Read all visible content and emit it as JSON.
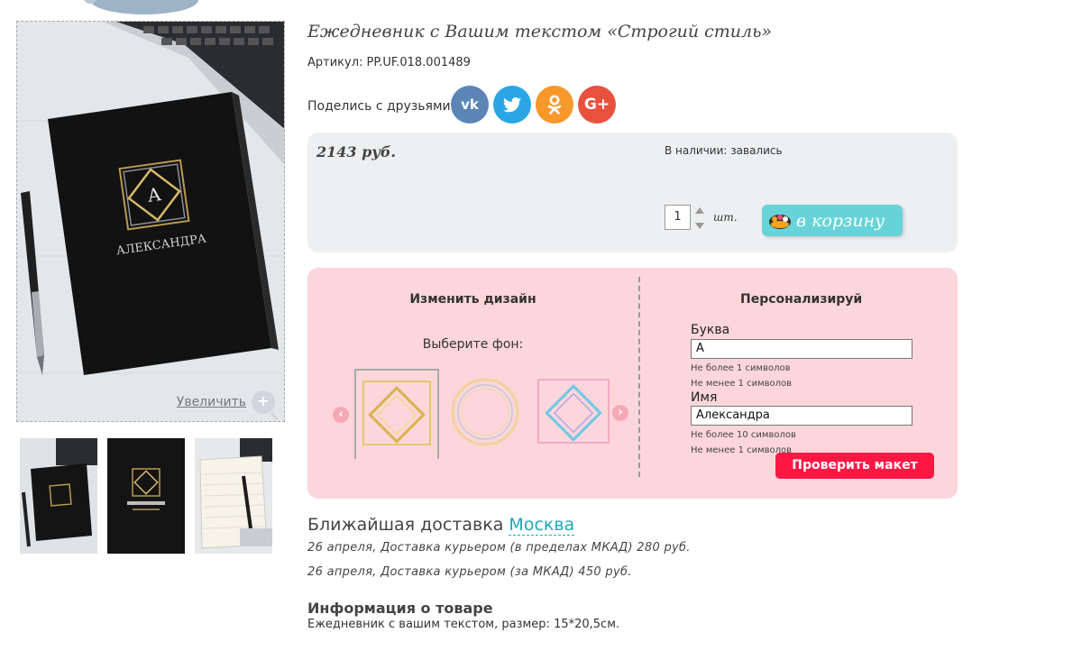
{
  "product": {
    "title": "Ежедневник с Вашим текстом «Строгий стиль»",
    "sku_label": "Артикул: PP.UF.018.001489",
    "share_label": "Поделись с друзьями:",
    "socials": [
      "vk",
      "twitter",
      "odnoklassniki",
      "google-plus"
    ],
    "cover_text": "АЛЕКСАНДРА",
    "cover_letter": "А",
    "zoom_label": "Увеличить"
  },
  "purchase": {
    "price": "2143 руб.",
    "stock": "В наличии: завались",
    "quantity": "1",
    "unit": "шт.",
    "cart_button": "в корзину"
  },
  "design": {
    "heading": "Изменить дизайн",
    "background_label": "Выберите фон:"
  },
  "personalize": {
    "heading": "Персонализируй",
    "letter_label": "Буква",
    "letter_value": "А",
    "letter_max": "Не более 1 символов",
    "letter_min": "Не менее 1 символов",
    "name_label": "Имя",
    "name_value": "Александра",
    "name_max": "Не более 10 символов",
    "name_min": "Не менее 1 символов",
    "check_button": "Проверить макет"
  },
  "delivery": {
    "heading": "Ближайшая доставка",
    "city": "Москва",
    "line1": "26 апреля, Доставка курьером (в пределах МКАД) 280 руб.",
    "line2": "26 апреля, Доставка курьером (за МКАД) 450 руб."
  },
  "info": {
    "heading": "Информация о товаре",
    "text": "Ежедневник с вашим текстом, размер: 15*20,5см."
  },
  "colors": {
    "price_box": "#edeff1",
    "personalize_box": "#fcd6db",
    "cart_button": "#67d3d9",
    "check_button": "#ff1744",
    "city_link": "#1fa8b8"
  }
}
